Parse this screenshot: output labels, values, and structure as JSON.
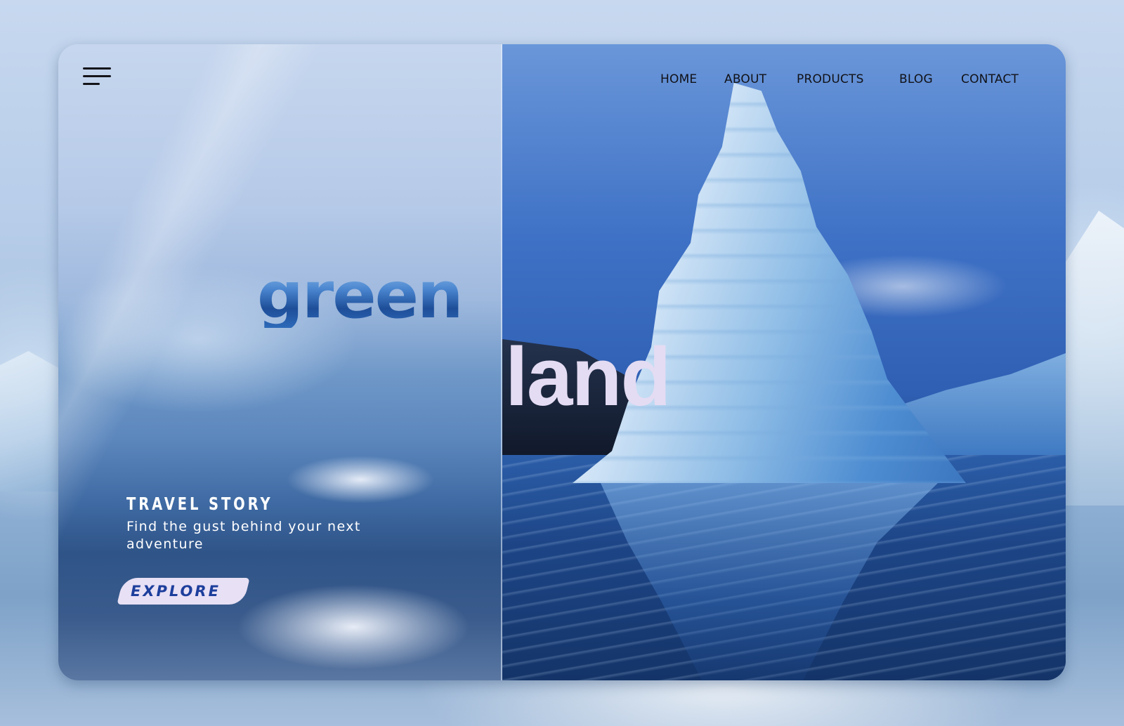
{
  "nav": {
    "items": [
      {
        "label": "HOME"
      },
      {
        "label": "ABOUT"
      },
      {
        "label": "PRODUCTS"
      },
      {
        "label": "BLOG"
      },
      {
        "label": "CONTACT"
      }
    ]
  },
  "hero": {
    "title_part1": "green",
    "title_part2": "land",
    "story_heading": "TRAVEL STORY",
    "story_subtitle": "Find the gust behind your next adventure",
    "cta_label": "EXPLORE"
  },
  "icons": {
    "menu": "hamburger-menu-icon"
  },
  "colors": {
    "nav_text": "#111217",
    "land_text": "#e4dcf3",
    "cta_background": "#e8e0f5",
    "cta_text": "#1d3f9c",
    "story_text": "#ffffff"
  }
}
